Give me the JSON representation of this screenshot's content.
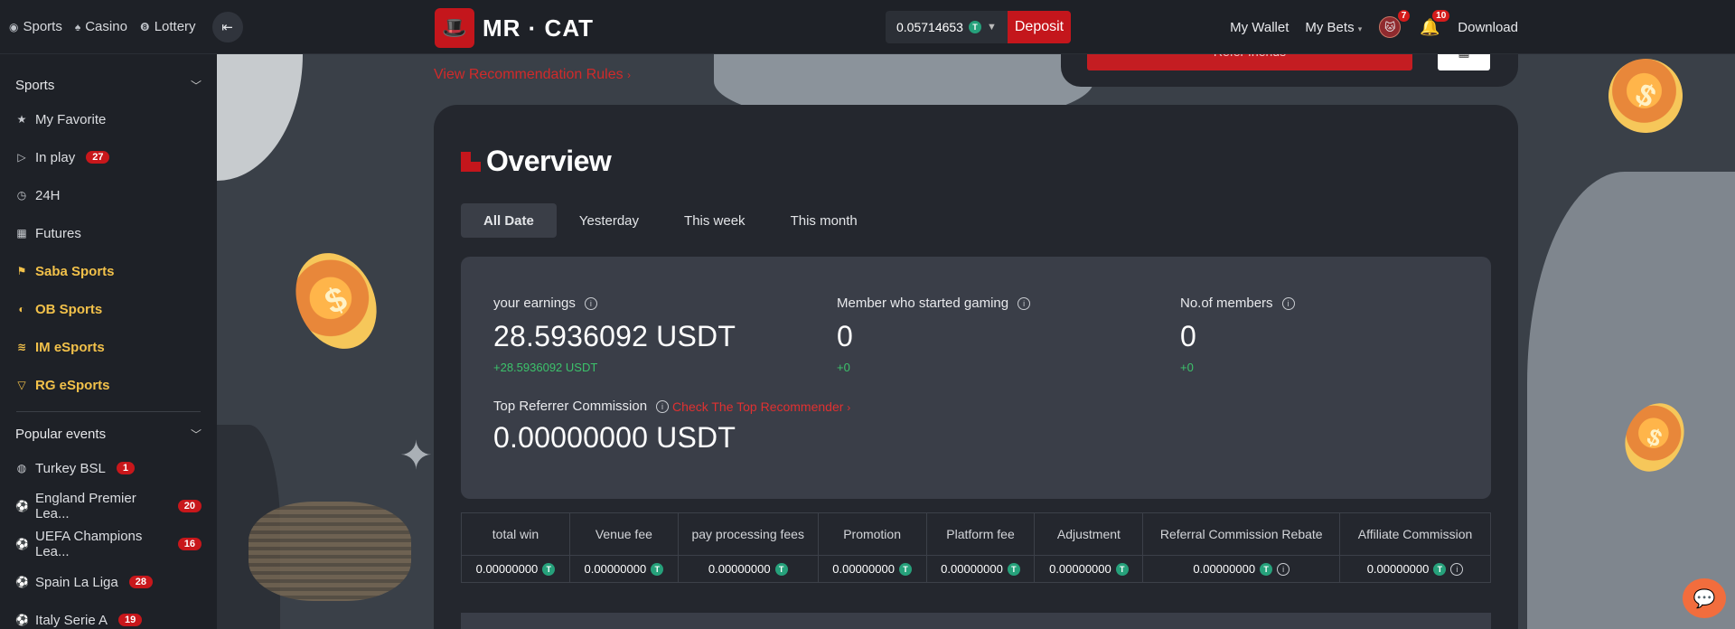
{
  "topnav": {
    "items": [
      {
        "label": "Sports",
        "icon": "sports-ball-icon"
      },
      {
        "label": "Casino",
        "icon": "casino-cards-icon"
      },
      {
        "label": "Lottery",
        "icon": "lottery-icon"
      }
    ]
  },
  "brand": {
    "name": "MR · CAT"
  },
  "wallet": {
    "amount": "0.05714653",
    "deposit_label": "Deposit"
  },
  "right_nav": {
    "my_wallet": "My Wallet",
    "my_bets": "My Bets",
    "avatar_count": "7",
    "notification_count": "10",
    "download": "Download"
  },
  "sidebar": {
    "sports_section": "Sports",
    "items": [
      {
        "label": "My Favorite",
        "icon": "star-icon"
      },
      {
        "label": "In play",
        "icon": "play-circle-icon",
        "badge": "27"
      },
      {
        "label": "24H",
        "icon": "clock-24h-icon"
      },
      {
        "label": "Futures",
        "icon": "calendar-icon"
      },
      {
        "label": "Saba Sports",
        "icon": "saba-icon",
        "highlight": true
      },
      {
        "label": "OB Sports",
        "icon": "ob-icon",
        "highlight": true
      },
      {
        "label": "IM eSports",
        "icon": "im-icon",
        "highlight": true
      },
      {
        "label": "RG eSports",
        "icon": "rg-icon",
        "highlight": true
      }
    ],
    "popular_section": "Popular events",
    "events": [
      {
        "label": "Turkey BSL",
        "badge": "1"
      },
      {
        "label": "England Premier Lea...",
        "badge": "20"
      },
      {
        "label": "UEFA Champions Lea...",
        "badge": "16"
      },
      {
        "label": "Spain La Liga",
        "badge": "28"
      },
      {
        "label": "Italy Serie A",
        "badge": "19"
      }
    ]
  },
  "referral": {
    "refer_button": "Refer friends",
    "rules_link": "View Recommendation Rules"
  },
  "overview": {
    "title": "Overview",
    "tabs": [
      "All Date",
      "Yesterday",
      "This week",
      "This month"
    ],
    "earnings_label": "your earnings",
    "earnings_value": "28.5936092 USDT",
    "earnings_change": "+28.5936092 USDT",
    "gaming_label": "Member who started gaming",
    "gaming_value": "0",
    "gaming_change": "+0",
    "members_label": "No.of members",
    "members_value": "0",
    "members_change": "+0",
    "top_label": "Top Referrer Commission",
    "top_link": "Check The Top Recommender",
    "top_value": "0.00000000 USDT"
  },
  "fees": {
    "headers": [
      "total win",
      "Venue fee",
      "pay processing fees",
      "Promotion",
      "Platform fee",
      "Adjustment",
      "Referral Commission Rebate",
      "Affiliate Commission"
    ],
    "values": [
      "0.00000000",
      "0.00000000",
      "0.00000000",
      "0.00000000",
      "0.00000000",
      "0.00000000",
      "0.00000000",
      "0.00000000"
    ]
  },
  "colors": {
    "brand_red": "#c4161c",
    "positive_green": "#3cc26b",
    "gold": "#f2c14a",
    "tether": "#26a17b"
  }
}
